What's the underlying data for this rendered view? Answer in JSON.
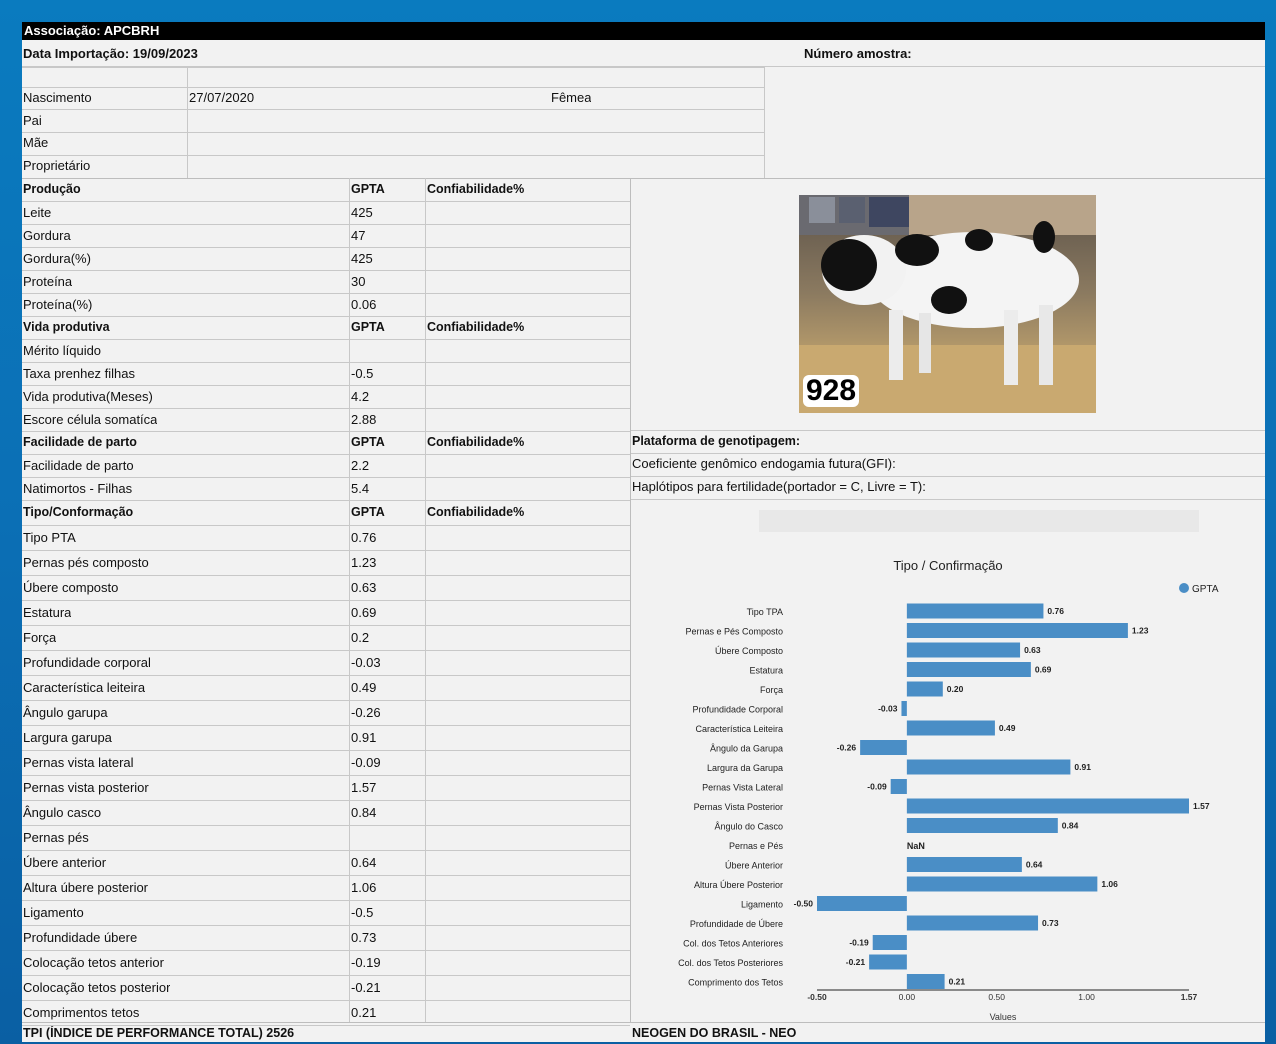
{
  "header": {
    "association": "Associação: APCBRH",
    "import_date": "Data Importação: 19/09/2023",
    "sample_number": "Número amostra:"
  },
  "animal": {
    "birth_label": "Nascimento",
    "birth_date": "27/07/2020",
    "sex": "Fêmea",
    "sire_label": "Pai",
    "dam_label": "Mãe",
    "owner_label": "Proprietário"
  },
  "columns": {
    "gpta": "GPTA",
    "reliability": "Confiabilidade%"
  },
  "sections": [
    {
      "title": "Produção",
      "rows": [
        {
          "label": "Leite",
          "value": "425"
        },
        {
          "label": "Gordura",
          "value": "47"
        },
        {
          "label": "Gordura(%)",
          "value": "425"
        },
        {
          "label": "Proteína",
          "value": "30"
        },
        {
          "label": "Proteína(%)",
          "value": "0.06"
        }
      ]
    },
    {
      "title": "Vida produtiva",
      "rows": [
        {
          "label": "Mérito líquido",
          "value": ""
        },
        {
          "label": "Taxa prenhez filhas",
          "value": "-0.5"
        },
        {
          "label": "Vida produtiva(Meses)",
          "value": "4.2"
        },
        {
          "label": "Escore célula somatíca",
          "value": "2.88"
        }
      ]
    },
    {
      "title": "Facilidade de parto",
      "rows": [
        {
          "label": "Facilidade de parto",
          "value": "2.2"
        },
        {
          "label": "Natimortos - Filhas",
          "value": "5.4"
        }
      ]
    },
    {
      "title": "Tipo/Conformação",
      "rows": [
        {
          "label": "Tipo PTA",
          "value": "0.76"
        },
        {
          "label": "Pernas pés composto",
          "value": "1.23"
        },
        {
          "label": "Úbere composto",
          "value": "0.63"
        },
        {
          "label": "Estatura",
          "value": "0.69"
        },
        {
          "label": "Força",
          "value": "0.2"
        },
        {
          "label": "Profundidade corporal",
          "value": "-0.03"
        },
        {
          "label": "Característica leiteira",
          "value": "0.49"
        },
        {
          "label": "Ângulo garupa",
          "value": "-0.26"
        },
        {
          "label": "Largura garupa",
          "value": "0.91"
        },
        {
          "label": "Pernas vista lateral",
          "value": "-0.09"
        },
        {
          "label": "Pernas vista posterior",
          "value": "1.57"
        },
        {
          "label": "Ângulo casco",
          "value": "0.84"
        },
        {
          "label": "Pernas pés",
          "value": ""
        },
        {
          "label": "Úbere anterior",
          "value": "0.64"
        },
        {
          "label": "Altura úbere posterior",
          "value": "1.06"
        },
        {
          "label": "Ligamento",
          "value": "-0.5"
        },
        {
          "label": "Profundidade úbere",
          "value": "0.73"
        },
        {
          "label": "Colocação tetos anterior",
          "value": "-0.19"
        },
        {
          "label": "Colocação tetos posterior",
          "value": "-0.21"
        },
        {
          "label": "Comprimentos tetos",
          "value": "0.21"
        }
      ]
    }
  ],
  "right_info": {
    "platform": "Plataforma de genotipagem:",
    "gfi": "Coeficiente genômico endogamia futura(GFI):",
    "haplotypes": "Haplótipos para fertilidade(portador = C, Livre = T):"
  },
  "photo": {
    "label": "928"
  },
  "footer": {
    "tpi": "TPI (ÍNDICE DE PERFORMANCE TOTAL) 2526",
    "lab": "NEOGEN DO BRASIL - NEO"
  },
  "chart_data": {
    "type": "bar",
    "orientation": "horizontal",
    "title": "Tipo / Confirmação",
    "xlabel": "Values",
    "legend": "GPTA",
    "legend_position": "top-right",
    "series_color": "#4a8ec6",
    "xlim": [
      -0.5,
      1.57
    ],
    "xticks": [
      "-0.50",
      "0.00",
      "0.50",
      "1.00",
      "1.57"
    ],
    "categories": [
      "Tipo TPA",
      "Pernas e Pés Composto",
      "Úbere Composto",
      "Estatura",
      "Força",
      "Profundidade Corporal",
      "Característica Leiteira",
      "Ângulo da Garupa",
      "Largura da Garupa",
      "Pernas Vista Lateral",
      "Pernas Vista Posterior",
      "Ângulo do Casco",
      "Pernas e Pés",
      "Úbere Anterior",
      "Altura Úbere Posterior",
      "Ligamento",
      "Profundidade de Úbere",
      "Col. dos Tetos Anteriores",
      "Col. dos Tetos Posteriores",
      "Comprimento dos Tetos"
    ],
    "values": [
      0.76,
      1.23,
      0.63,
      0.69,
      0.2,
      -0.03,
      0.49,
      -0.26,
      0.91,
      -0.09,
      1.57,
      0.84,
      null,
      0.64,
      1.06,
      -0.5,
      0.73,
      -0.19,
      -0.21,
      0.21
    ],
    "labels": [
      "0.76",
      "1.23",
      "0.63",
      "0.69",
      "0.20",
      "-0.03",
      "0.49",
      "-0.26",
      "0.91",
      "-0.09",
      "1.57",
      "0.84",
      "NaN",
      "0.64",
      "1.06",
      "-0.50",
      "0.73",
      "-0.19",
      "-0.21",
      "0.21"
    ]
  }
}
